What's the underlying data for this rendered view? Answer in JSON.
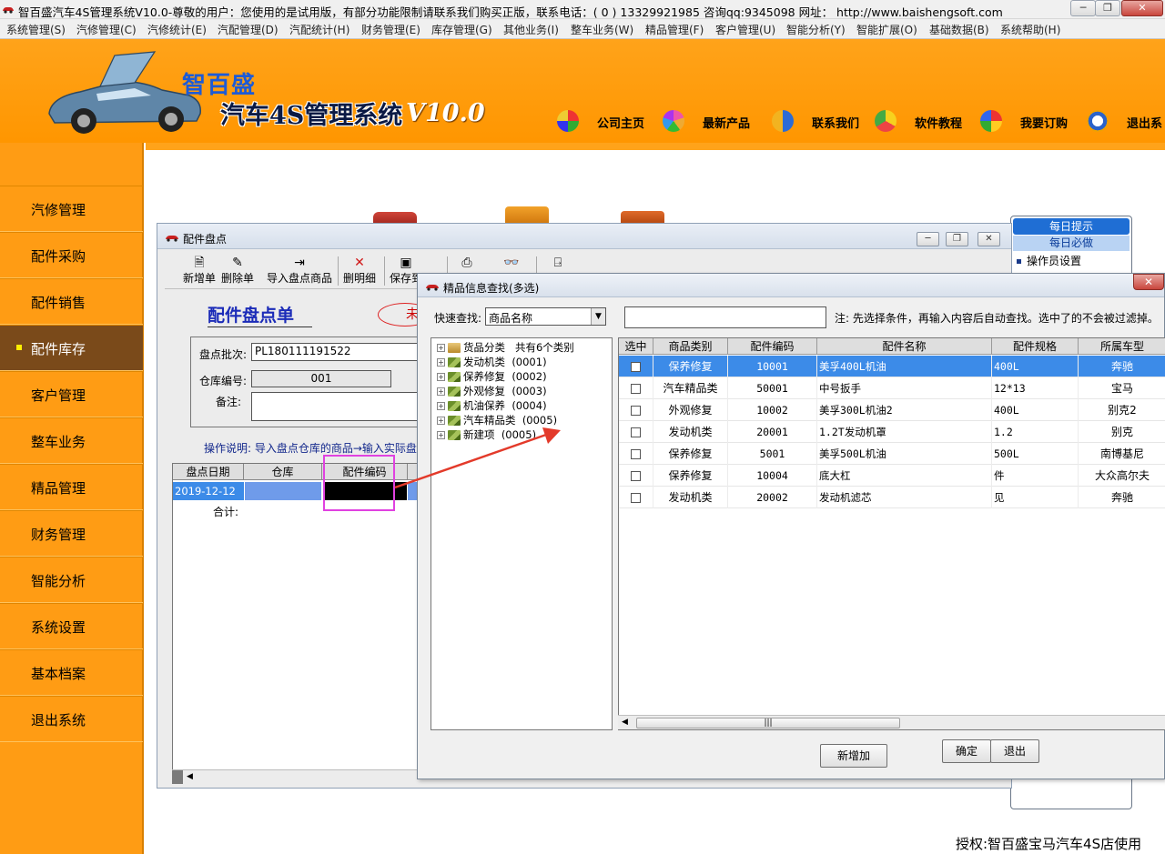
{
  "titlebar": {
    "title": "智百盛汽车4S管理系统V10.0-尊敬的用户：您使用的是试用版，有部分功能限制请联系我们购买正版，联系电话：( 0 ) 13329921985  咨询qq:9345098   网址： http://www.baishengsoft.com",
    "minimize": "─",
    "maximize": "❐",
    "close": "✕"
  },
  "menubar": [
    "系统管理(S)",
    "汽修管理(C)",
    "汽修统计(E)",
    "汽配管理(D)",
    "汽配统计(H)",
    "财务管理(E)",
    "库存管理(G)",
    "其他业务(I)",
    "整车业务(W)",
    "精品管理(F)",
    "客户管理(U)",
    "智能分析(Y)",
    "智能扩展(O)",
    "基础数据(B)",
    "系统帮助(H)"
  ],
  "header": {
    "brand_small": "智百盛",
    "brand_main": "汽车4S管理系统",
    "brand_version": "V10.0",
    "nav": [
      "公司主页",
      "最新产品",
      "联系我们",
      "软件教程",
      "我要订购",
      "退出系"
    ]
  },
  "sidebar": {
    "items": [
      "汽修管理",
      "配件采购",
      "配件销售",
      "配件库存",
      "客户管理",
      "整车业务",
      "精品管理",
      "财务管理",
      "智能分析",
      "系统设置",
      "基本档案",
      "退出系统"
    ],
    "active_index": 3
  },
  "tips": {
    "title": "每日提示",
    "subtitle": "每日必做",
    "item": "操作员设置"
  },
  "stocktake": {
    "window_title": "配件盘点",
    "toolbar": [
      "新增单",
      "删除单",
      "导入盘点商品",
      "删明细",
      "保存到"
    ],
    "heading": "配件盘点单",
    "badge": "未",
    "batch_label": "盘点批次:",
    "batch_value": "PL180111191522",
    "warehouse_label": "仓库编号:",
    "warehouse_value": "001",
    "remark_label": "备注:",
    "help": "操作说明: 导入盘点仓库的商品→输入实际盘",
    "grid_headers": [
      "盘点日期",
      "仓库",
      "配件编码"
    ],
    "row_date": "2019-12-12",
    "total_label": "合计:"
  },
  "lookup": {
    "title": "精品信息查找(多选)",
    "search_label": "快速查找:",
    "search_select": "商品名称",
    "note": "注: 先选择条件，再输入内容后自动查找。选中了的不会被过滤掉。",
    "tree": [
      {
        "label": "货品分类",
        "extra": "共有6个类别"
      },
      {
        "label": "发动机类",
        "extra": "(0001)"
      },
      {
        "label": "保养修复",
        "extra": "(0002)"
      },
      {
        "label": "外观修复",
        "extra": "(0003)"
      },
      {
        "label": "机油保养",
        "extra": "(0004)"
      },
      {
        "label": "汽车精品类",
        "extra": "(0005)"
      },
      {
        "label": "新建项",
        "extra": "(0005)"
      }
    ],
    "columns": [
      "选中",
      "商品类别",
      "配件编码",
      "配件名称",
      "配件规格",
      "所属车型"
    ],
    "rows": [
      {
        "category": "保养修复",
        "code": "10001",
        "name": "美孚400L机油",
        "spec": "400L",
        "model": "奔驰"
      },
      {
        "category": "汽车精品类",
        "code": "50001",
        "name": "中号扳手",
        "spec": "12*13",
        "model": "宝马"
      },
      {
        "category": "外观修复",
        "code": "10002",
        "name": "美孚300L机油2",
        "spec": "400L",
        "model": "别克2"
      },
      {
        "category": "发动机类",
        "code": "20001",
        "name": "1.2T发动机罩",
        "spec": "1.2",
        "model": "别克"
      },
      {
        "category": "保养修复",
        "code": "5001",
        "name": "美孚500L机油",
        "spec": "500L",
        "model": "南博基尼"
      },
      {
        "category": "保养修复",
        "code": "10004",
        "name": "底大杠",
        "spec": "件",
        "model": "大众高尔夫"
      },
      {
        "category": "发动机类",
        "code": "20002",
        "name": "发动机滤芯",
        "spec": "见",
        "model": "奔驰"
      }
    ],
    "btn_add": "新增加",
    "btn_ok": "确定",
    "btn_exit": "退出"
  },
  "footer": "授权:智百盛宝马汽车4S店使用"
}
